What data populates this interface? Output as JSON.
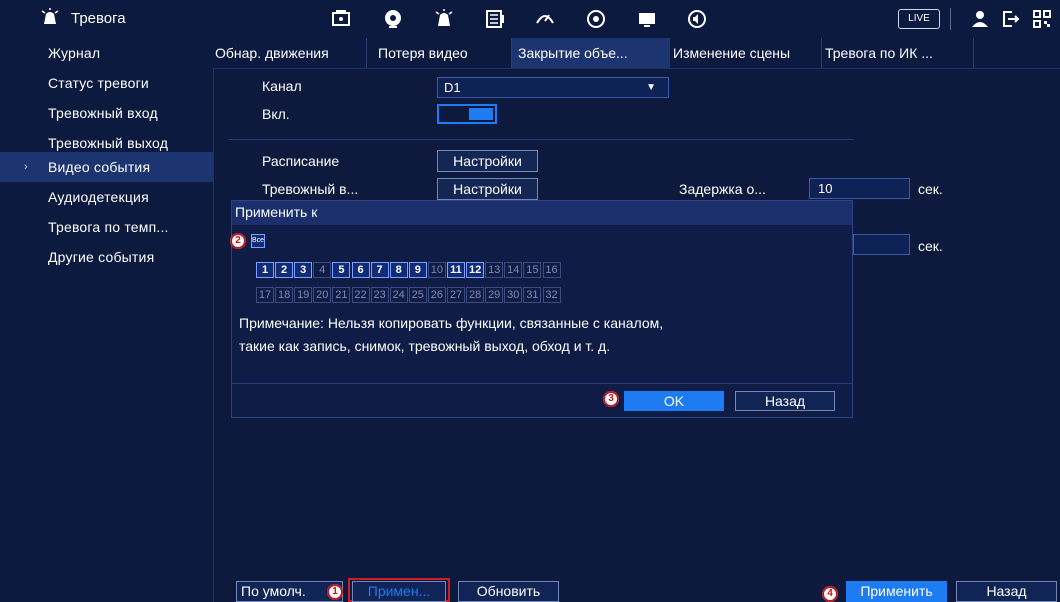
{
  "header": {
    "title": "Тревога",
    "live_label": "LIVE",
    "icons": [
      "alarm-icon",
      "camera-icon",
      "network-icon",
      "alarm-icon",
      "storage-icon",
      "system-icon",
      "ptz-icon",
      "display-icon",
      "audio-icon",
      "user-icon",
      "logout-icon",
      "qr-icon"
    ]
  },
  "sidebar": {
    "items": [
      {
        "label": "Журнал"
      },
      {
        "label": "Статус тревоги"
      },
      {
        "label": "Тревожный вход"
      },
      {
        "label": "Тревожный выход"
      },
      {
        "label": "Видео события"
      },
      {
        "label": "Аудиодетекция"
      },
      {
        "label": "Тревога по темп..."
      },
      {
        "label": "Другие события"
      }
    ],
    "active_index": 4
  },
  "tabs": [
    {
      "label": "Обнар. движения"
    },
    {
      "label": "Потеря видео"
    },
    {
      "label": "Закрытие объе..."
    },
    {
      "label": "Изменение сцены"
    },
    {
      "label": "Тревога по ИК ..."
    }
  ],
  "form": {
    "channel_label": "Канал",
    "channel_value": "D1",
    "enable_label": "Вкл.",
    "schedule_label": "Расписание",
    "schedule_btn": "Настройки",
    "alarm_out_label": "Тревожный в...",
    "alarm_out_btn": "Настройки",
    "delay_label": "Задержка о...",
    "delay_value": "10",
    "sec_label_1": "сек.",
    "sec_label_2": "сек."
  },
  "modal": {
    "title": "Применить к",
    "all_label": "Все",
    "channels_row1": [
      "1",
      "2",
      "3",
      "4",
      "5",
      "6",
      "7",
      "8",
      "9",
      "10",
      "11",
      "12",
      "13",
      "14",
      "15",
      "16"
    ],
    "channels_row2": [
      "17",
      "18",
      "19",
      "20",
      "21",
      "22",
      "23",
      "24",
      "25",
      "26",
      "27",
      "28",
      "29",
      "30",
      "31",
      "32"
    ],
    "enabled_channels": [
      "1",
      "2",
      "3",
      "5",
      "6",
      "7",
      "8",
      "9",
      "11",
      "12"
    ],
    "note_line1": "Примечание: Нельзя копировать функции, связанные с каналом,",
    "note_line2": "такие как запись, снимок, тревожный выход, обход и т. д.",
    "ok_label": "OK",
    "back_label": "Назад"
  },
  "bottom": {
    "default_label": "По умолч.",
    "apply_to_label": "Примен...",
    "refresh_label": "Обновить",
    "apply_label": "Применить",
    "back_label": "Назад"
  },
  "markers": [
    "1",
    "2",
    "3",
    "4"
  ],
  "colors": {
    "accent": "#1d7cf2",
    "marker": "#c2141f",
    "background": "#0d1a3d"
  }
}
